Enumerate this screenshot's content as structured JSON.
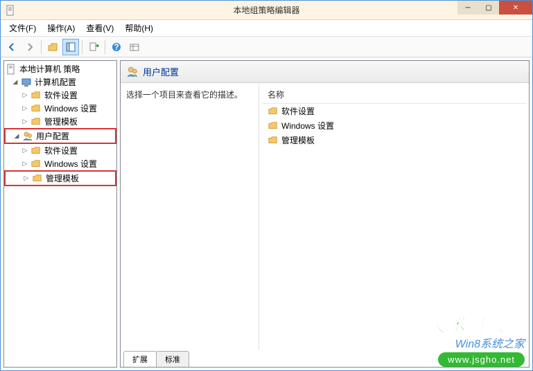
{
  "window": {
    "title": "本地组策略编辑器"
  },
  "menu": {
    "file": "文件(F)",
    "action": "操作(A)",
    "view": "查看(V)",
    "help": "帮助(H)"
  },
  "tree": {
    "root": "本地计算机 策略",
    "computer": "计算机配置",
    "software1": "软件设置",
    "windows1": "Windows 设置",
    "admin1": "管理模板",
    "user": "用户配置",
    "software2": "软件设置",
    "windows2": "Windows 设置",
    "admin2": "管理模板"
  },
  "detail": {
    "header": "用户配置",
    "desc": "选择一个项目来查看它的描述。",
    "column_name": "名称",
    "items": {
      "0": "软件设置",
      "1": "Windows 设置",
      "2": "管理模板"
    }
  },
  "tabs": {
    "extended": "扩展",
    "standard": "标准"
  },
  "watermark": {
    "line1": "技术员联盟",
    "line2": "Win8系统之家",
    "line3": "www.jsgho.net"
  }
}
